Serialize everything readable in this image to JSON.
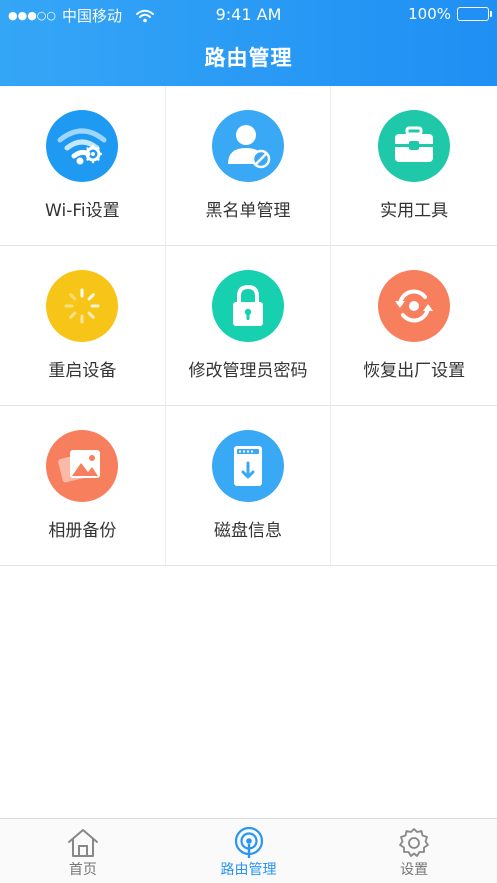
{
  "status_bar": {
    "signal": "●●●○○",
    "carrier": "中国移动",
    "time": "9:41 AM",
    "battery": "100%"
  },
  "header": {
    "title": "路由管理"
  },
  "grid": [
    {
      "label": "Wi-Fi设置",
      "icon": "wifi-settings-icon",
      "color": "#1e9af2"
    },
    {
      "label": "黑名单管理",
      "icon": "blocked-user-icon",
      "color": "#3aa9f5"
    },
    {
      "label": "实用工具",
      "icon": "toolbox-icon",
      "color": "#1fc8a8"
    },
    {
      "label": "重启设备",
      "icon": "restart-spinner-icon",
      "color": "#f7c518"
    },
    {
      "label": "修改管理员密码",
      "icon": "lock-icon",
      "color": "#17d0b0"
    },
    {
      "label": "恢复出厂设置",
      "icon": "factory-reset-icon",
      "color": "#f77f5e"
    },
    {
      "label": "相册备份",
      "icon": "photo-album-icon",
      "color": "#f77f5e"
    },
    {
      "label": "磁盘信息",
      "icon": "disk-info-icon",
      "color": "#3aa9f5"
    }
  ],
  "tabs": [
    {
      "label": "首页",
      "icon": "home-icon"
    },
    {
      "label": "路由管理",
      "icon": "router-icon",
      "active": true
    },
    {
      "label": "设置",
      "icon": "gear-icon"
    }
  ]
}
